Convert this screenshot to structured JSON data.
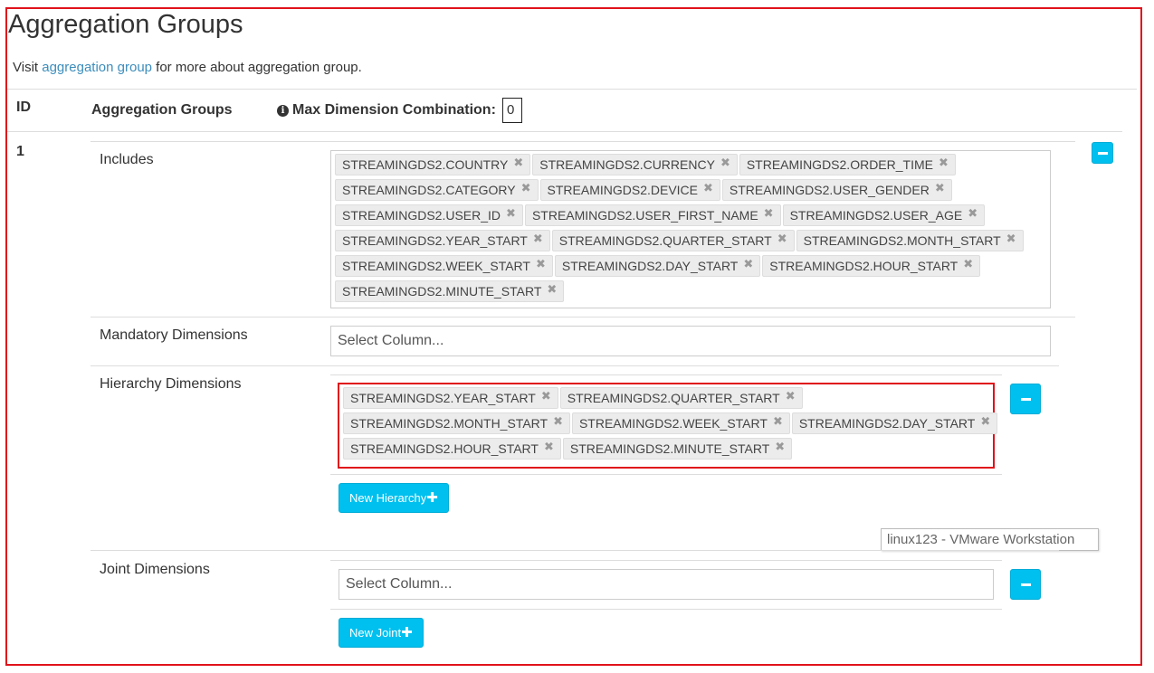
{
  "section": {
    "title": "Aggregation Groups",
    "visit_prefix": "Visit ",
    "visit_link": "aggregation group",
    "visit_suffix": " for more about aggregation group."
  },
  "table_header": {
    "id": "ID",
    "groups": "Aggregation Groups",
    "max_label": "Max Dimension Combination:",
    "max_value": "0"
  },
  "group": {
    "id": "1",
    "includes_label": "Includes",
    "includes_rows": [
      [
        "STREAMINGDS2.COUNTRY",
        "STREAMINGDS2.CURRENCY",
        "STREAMINGDS2.ORDER_TIME"
      ],
      [
        "STREAMINGDS2.CATEGORY",
        "STREAMINGDS2.DEVICE",
        "STREAMINGDS2.USER_GENDER"
      ],
      [
        "STREAMINGDS2.USER_ID",
        "STREAMINGDS2.USER_FIRST_NAME",
        "STREAMINGDS2.USER_AGE"
      ],
      [
        "STREAMINGDS2.YEAR_START",
        "STREAMINGDS2.QUARTER_START",
        "STREAMINGDS2.MONTH_START"
      ],
      [
        "STREAMINGDS2.WEEK_START",
        "STREAMINGDS2.DAY_START",
        "STREAMINGDS2.HOUR_START"
      ],
      [
        "STREAMINGDS2.MINUTE_START"
      ]
    ],
    "mandatory_label": "Mandatory Dimensions",
    "mandatory_placeholder": "Select Column...",
    "hierarchy_label": "Hierarchy Dimensions",
    "hierarchy_rows": [
      [
        "STREAMINGDS2.YEAR_START",
        "STREAMINGDS2.QUARTER_START"
      ],
      [
        "STREAMINGDS2.MONTH_START",
        "STREAMINGDS2.WEEK_START",
        "STREAMINGDS2.DAY_START"
      ],
      [
        "STREAMINGDS2.HOUR_START",
        "STREAMINGDS2.MINUTE_START"
      ]
    ],
    "new_hierarchy_label": "New Hierarchy",
    "joint_label": "Joint Dimensions",
    "joint_placeholder": "Select Column...",
    "new_joint_label": "New Joint"
  },
  "tooltip": "linux123 - VMware Workstation",
  "icons": {
    "info": "info-circle-icon",
    "remove": "times-icon",
    "minus": "minus-icon",
    "plus": "plus-icon"
  },
  "colors": {
    "accent": "#00c0ef",
    "link": "#3c8dbc",
    "highlight": "#e0121b"
  }
}
